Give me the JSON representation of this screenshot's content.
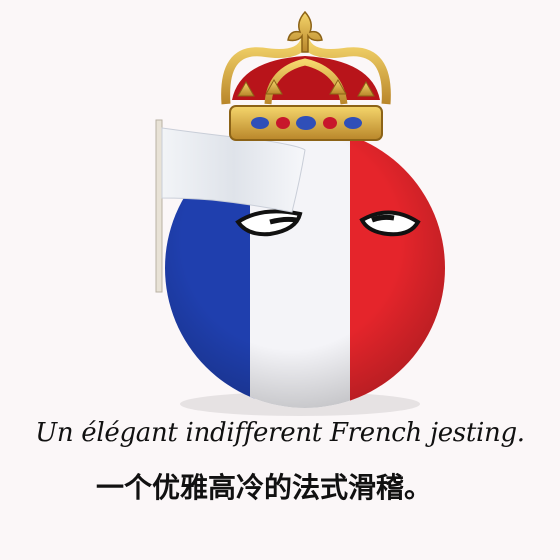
{
  "image": {
    "subject": "countryball-france",
    "captions": {
      "english": "Un élégant indifferent French jesting.",
      "chinese": "一个优雅高冷的法式滑稽。"
    },
    "watermark": "",
    "colors": {
      "blue": "#1f3fae",
      "white": "#f4f4f8",
      "red": "#e5252b",
      "gold": "#e2b13a",
      "crown_red": "#b8141a",
      "background": "#fbf7f8"
    }
  }
}
